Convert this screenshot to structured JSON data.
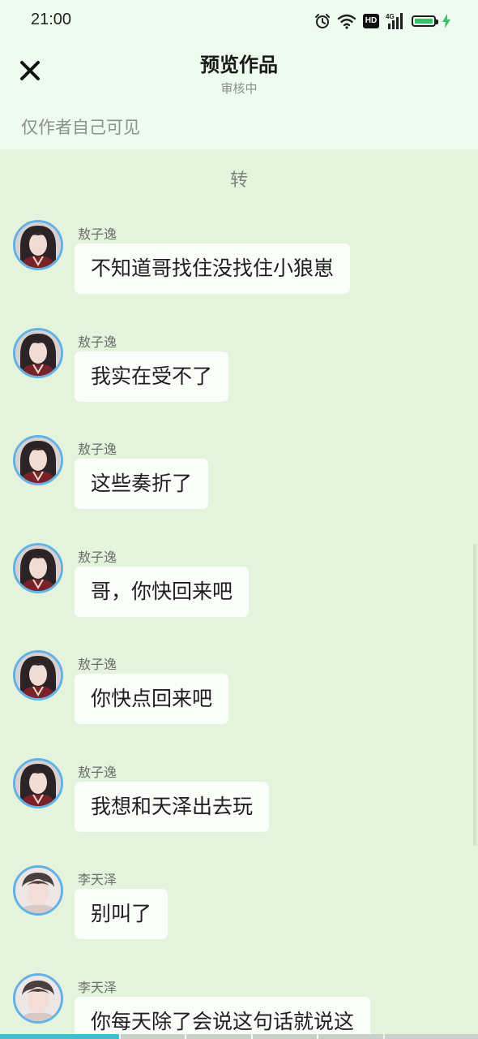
{
  "status_bar": {
    "time": "21:00",
    "icons": [
      "alarm-icon",
      "wifi-icon",
      "hd-icon",
      "signal-4g-icon",
      "battery-icon",
      "charging-icon"
    ],
    "hd_label": "HD",
    "network_label": "4G"
  },
  "header": {
    "close_icon": "close-icon",
    "title": "预览作品",
    "subtitle": "审核中",
    "visibility_note": "仅作者自己可见"
  },
  "chat": {
    "header_text": "转",
    "messages": [
      {
        "sender": "敖子逸",
        "text": "不知道哥找住没找住小狼崽",
        "avatar": "avatar-aoziyi"
      },
      {
        "sender": "敖子逸",
        "text": "我实在受不了",
        "avatar": "avatar-aoziyi"
      },
      {
        "sender": "敖子逸",
        "text": "这些奏折了",
        "avatar": "avatar-aoziyi"
      },
      {
        "sender": "敖子逸",
        "text": "哥，你快回来吧",
        "avatar": "avatar-aoziyi"
      },
      {
        "sender": "敖子逸",
        "text": "你快点回来吧",
        "avatar": "avatar-aoziyi"
      },
      {
        "sender": "敖子逸",
        "text": "我想和天泽出去玩",
        "avatar": "avatar-aoziyi"
      },
      {
        "sender": "李天泽",
        "text": "别叫了",
        "avatar": "avatar-litianze"
      },
      {
        "sender": "李天泽",
        "text": "你每天除了会说这句话就说这",
        "avatar": "avatar-litianze"
      }
    ]
  },
  "colors": {
    "topbar_bg": "#eefbef",
    "chat_bg": "#e4f3dc",
    "bubble_bg": "#fbfdfa",
    "avatar_ring": "#62b2e6",
    "battery_green": "#36c26a",
    "progress_accent": "#37c3cf"
  }
}
